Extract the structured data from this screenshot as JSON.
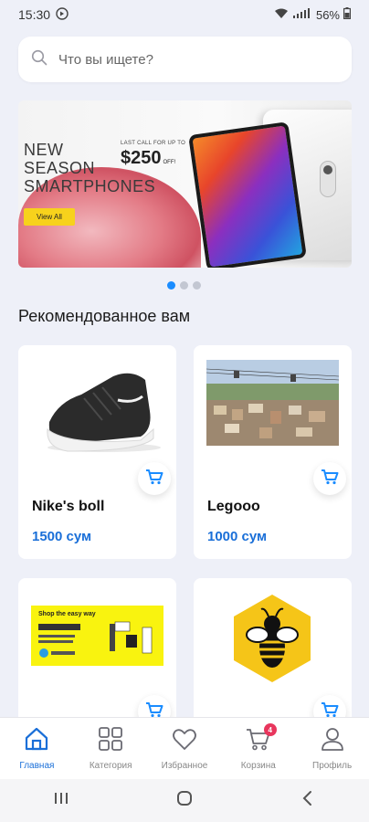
{
  "status_bar": {
    "time": "15:30",
    "battery": "56%"
  },
  "search": {
    "placeholder": "Что вы ищете?"
  },
  "banner": {
    "headline_1": "NEW",
    "headline_2": "SEASON",
    "headline_3": "SMARTPHONES",
    "offer_small": "LAST CALL FOR UP TO",
    "offer_price": "$250",
    "offer_suffix": "OFF!",
    "cta_label": "View All"
  },
  "carousel": {
    "page_count": 3,
    "active_index": 0
  },
  "section": {
    "title": "Рекомендованное вам"
  },
  "products": [
    {
      "name": "Nike's boll",
      "price": "1500 сум"
    },
    {
      "name": "Legooo",
      "price": "1000 сум"
    },
    {
      "name": "",
      "price": "",
      "ad_text": "Shop the easy way"
    },
    {
      "name": "",
      "price": ""
    }
  ],
  "bottom_nav": {
    "items": [
      {
        "label": "Главная",
        "icon": "home-icon"
      },
      {
        "label": "Категория",
        "icon": "grid-icon"
      },
      {
        "label": "Избранное",
        "icon": "heart-icon"
      },
      {
        "label": "Корзина",
        "icon": "cart-icon",
        "badge": "4"
      },
      {
        "label": "Профиль",
        "icon": "user-icon"
      }
    ]
  },
  "colors": {
    "accent": "#1a6fd8",
    "background": "#eef0f8",
    "badge": "#e8365d"
  }
}
